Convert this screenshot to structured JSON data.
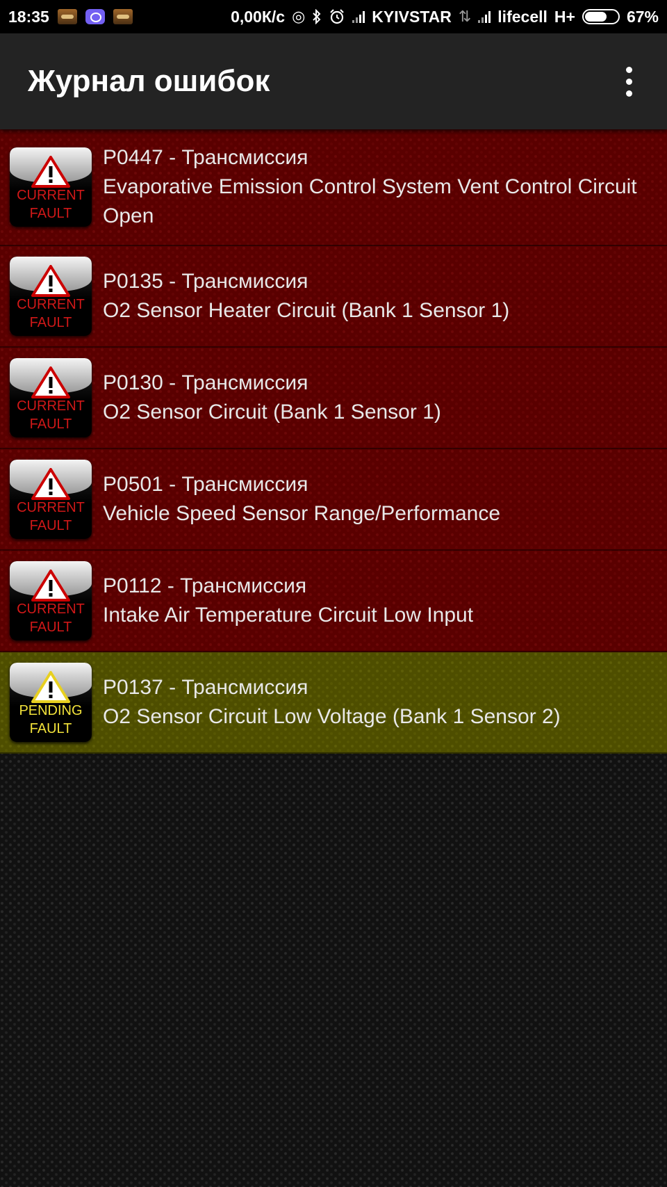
{
  "status_bar": {
    "time": "18:35",
    "net_speed": "0,00К/с",
    "carrier1": "KYIVSTAR",
    "carrier2": "lifecell",
    "network_type": "H+",
    "battery_percent": "67%",
    "battery_level": 0.67,
    "icons": [
      "car-app-icon",
      "viber-icon",
      "car-app-icon",
      "hotspot-icon",
      "bluetooth-icon",
      "alarm-icon",
      "signal-icon",
      "data-arrows-icon",
      "signal-icon",
      "battery-icon"
    ]
  },
  "app_bar": {
    "title": "Журнал ошибок",
    "menu_icon": "overflow-menu-icon"
  },
  "colors": {
    "current_fault_bg": "#5a0000",
    "pending_fault_bg": "#4e4e00",
    "current_badge_text": "#d01818",
    "pending_badge_text": "#f2e23a",
    "app_bar_bg": "#232323"
  },
  "faults": [
    {
      "type": "current",
      "badge_line1": "CURRENT",
      "badge_line2": "FAULT",
      "code_line": "P0447 - Трансмиссия",
      "description": "Evaporative Emission Control System Vent Control Circuit Open"
    },
    {
      "type": "current",
      "badge_line1": "CURRENT",
      "badge_line2": "FAULT",
      "code_line": "P0135 - Трансмиссия",
      "description": "O2 Sensor Heater Circuit (Bank 1 Sensor 1)"
    },
    {
      "type": "current",
      "badge_line1": "CURRENT",
      "badge_line2": "FAULT",
      "code_line": "P0130 - Трансмиссия",
      "description": "O2 Sensor Circuit (Bank 1 Sensor 1)"
    },
    {
      "type": "current",
      "badge_line1": "CURRENT",
      "badge_line2": "FAULT",
      "code_line": "P0501 - Трансмиссия",
      "description": "Vehicle Speed Sensor Range/Performance"
    },
    {
      "type": "current",
      "badge_line1": "CURRENT",
      "badge_line2": "FAULT",
      "code_line": "P0112 - Трансмиссия",
      "description": "Intake Air Temperature Circuit Low Input"
    },
    {
      "type": "pending",
      "badge_line1": "PENDING",
      "badge_line2": "FAULT",
      "code_line": "P0137 - Трансмиссия",
      "description": "O2 Sensor Circuit Low Voltage (Bank 1 Sensor 2)"
    }
  ]
}
